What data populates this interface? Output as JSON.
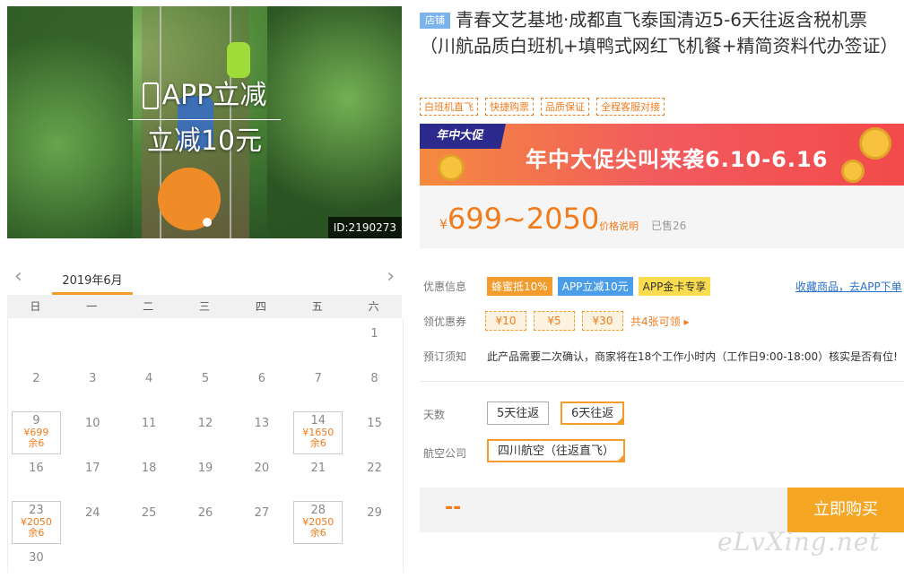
{
  "hero": {
    "promo_line1": "APP立减",
    "promo_line2": "立减10元",
    "product_id": "ID:2190273"
  },
  "calendar": {
    "month_label": "2019年6月",
    "weekdays": [
      "日",
      "一",
      "二",
      "三",
      "四",
      "五",
      "六"
    ],
    "days": [
      {
        "d": ""
      },
      {
        "d": ""
      },
      {
        "d": ""
      },
      {
        "d": ""
      },
      {
        "d": ""
      },
      {
        "d": ""
      },
      {
        "d": "1"
      },
      {
        "d": "2"
      },
      {
        "d": "3"
      },
      {
        "d": "4"
      },
      {
        "d": "5"
      },
      {
        "d": "6"
      },
      {
        "d": "7"
      },
      {
        "d": "8"
      },
      {
        "d": "9",
        "price": "¥699",
        "stock": "余6"
      },
      {
        "d": "10"
      },
      {
        "d": "11"
      },
      {
        "d": "12"
      },
      {
        "d": "13"
      },
      {
        "d": "14",
        "price": "¥1650",
        "stock": "余6"
      },
      {
        "d": "15"
      },
      {
        "d": "16"
      },
      {
        "d": "17"
      },
      {
        "d": "18"
      },
      {
        "d": "19"
      },
      {
        "d": "20"
      },
      {
        "d": "21"
      },
      {
        "d": "22"
      },
      {
        "d": "23",
        "price": "¥2050",
        "stock": "余6"
      },
      {
        "d": "24"
      },
      {
        "d": "25"
      },
      {
        "d": "26"
      },
      {
        "d": "27"
      },
      {
        "d": "28",
        "price": "¥2050",
        "stock": "余6"
      },
      {
        "d": "29"
      },
      {
        "d": "30"
      }
    ]
  },
  "product": {
    "shop_tag": "店铺",
    "title": "青春文艺基地·成都直飞泰国清迈5-6天往返含税机票（川航品质白班机+填鸭式网红飞机餐+精简资料代办签证）",
    "features": [
      "白班机直飞",
      "快捷购票",
      "品质保证",
      "全程客服对接"
    ]
  },
  "banner": {
    "badge": "年中大促",
    "text": "年中大促尖叫来袭6.10-6.16"
  },
  "price": {
    "currency": "¥",
    "range": "699~2050",
    "explain": "价格说明",
    "sold": "已售26"
  },
  "promotions": {
    "label": "优惠信息",
    "tags": [
      "蜂蜜抵10%",
      "APP立减10元",
      "APP金卡专享"
    ],
    "fav_link": "收藏商品，去APP下单"
  },
  "coupons": {
    "label": "领优惠券",
    "items": [
      "¥10",
      "¥5",
      "¥30"
    ],
    "total": "共4张可领 ▸"
  },
  "notice": {
    "label": "预订须知",
    "text": "此产品需要二次确认，商家将在18个工作小时内（工作日9:00-18:00）核实是否有位!"
  },
  "options": {
    "days_label": "天数",
    "days": [
      "5天往返",
      "6天往返"
    ],
    "airline_label": "航空公司",
    "airline": "四川航空（往返直飞）"
  },
  "buy": {
    "total": "--",
    "button": "立即购买"
  },
  "watermark": "eLvXing.net"
}
